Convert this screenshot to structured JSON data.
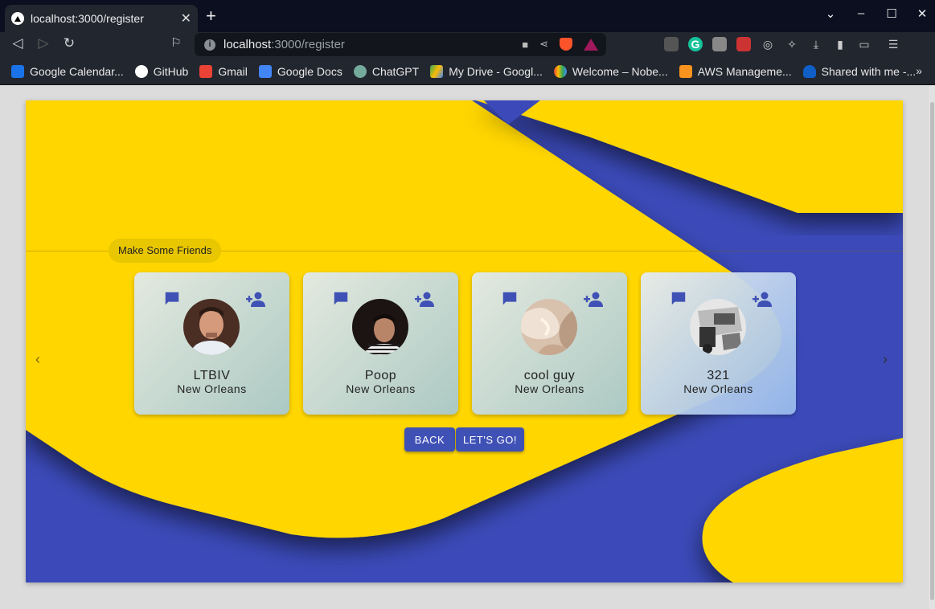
{
  "browser": {
    "tab_title": "localhost:3000/register",
    "url_host": "localhost",
    "url_path": ":3000/register",
    "bookmarks": [
      {
        "label": "Google Calendar...",
        "icon": "calendar-icon",
        "color": "#1a73e8"
      },
      {
        "label": "GitHub",
        "icon": "github-icon",
        "color": "#ffffff"
      },
      {
        "label": "Gmail",
        "icon": "gmail-icon",
        "color": "#ea4335"
      },
      {
        "label": "Google Docs",
        "icon": "docs-icon",
        "color": "#4285f4"
      },
      {
        "label": "ChatGPT",
        "icon": "chatgpt-icon",
        "color": "#74aa9c"
      },
      {
        "label": "My Drive - Googl...",
        "icon": "drive-icon",
        "color": "#fbbc04"
      },
      {
        "label": "Welcome – Nobe...",
        "icon": "cloud-icon",
        "color": "#4285f4"
      },
      {
        "label": "AWS Manageme...",
        "icon": "aws-icon",
        "color": "#f7931e"
      },
      {
        "label": "Shared with me -...",
        "icon": "onedrive-icon",
        "color": "#0f5fc7"
      }
    ]
  },
  "page": {
    "section_chip": "Make Some Friends",
    "friends": [
      {
        "name": "LTBIV",
        "city": "New Orleans"
      },
      {
        "name": "Poop",
        "city": "New Orleans"
      },
      {
        "name": "cool guy",
        "city": "New Orleans"
      },
      {
        "name": "321",
        "city": "New Orleans"
      }
    ],
    "back_label": "BACK",
    "go_label": "LET'S GO!"
  },
  "colors": {
    "accent": "#3f51b5",
    "background_yellow": "#ffd600",
    "background_blue": "#3b4ab8"
  }
}
